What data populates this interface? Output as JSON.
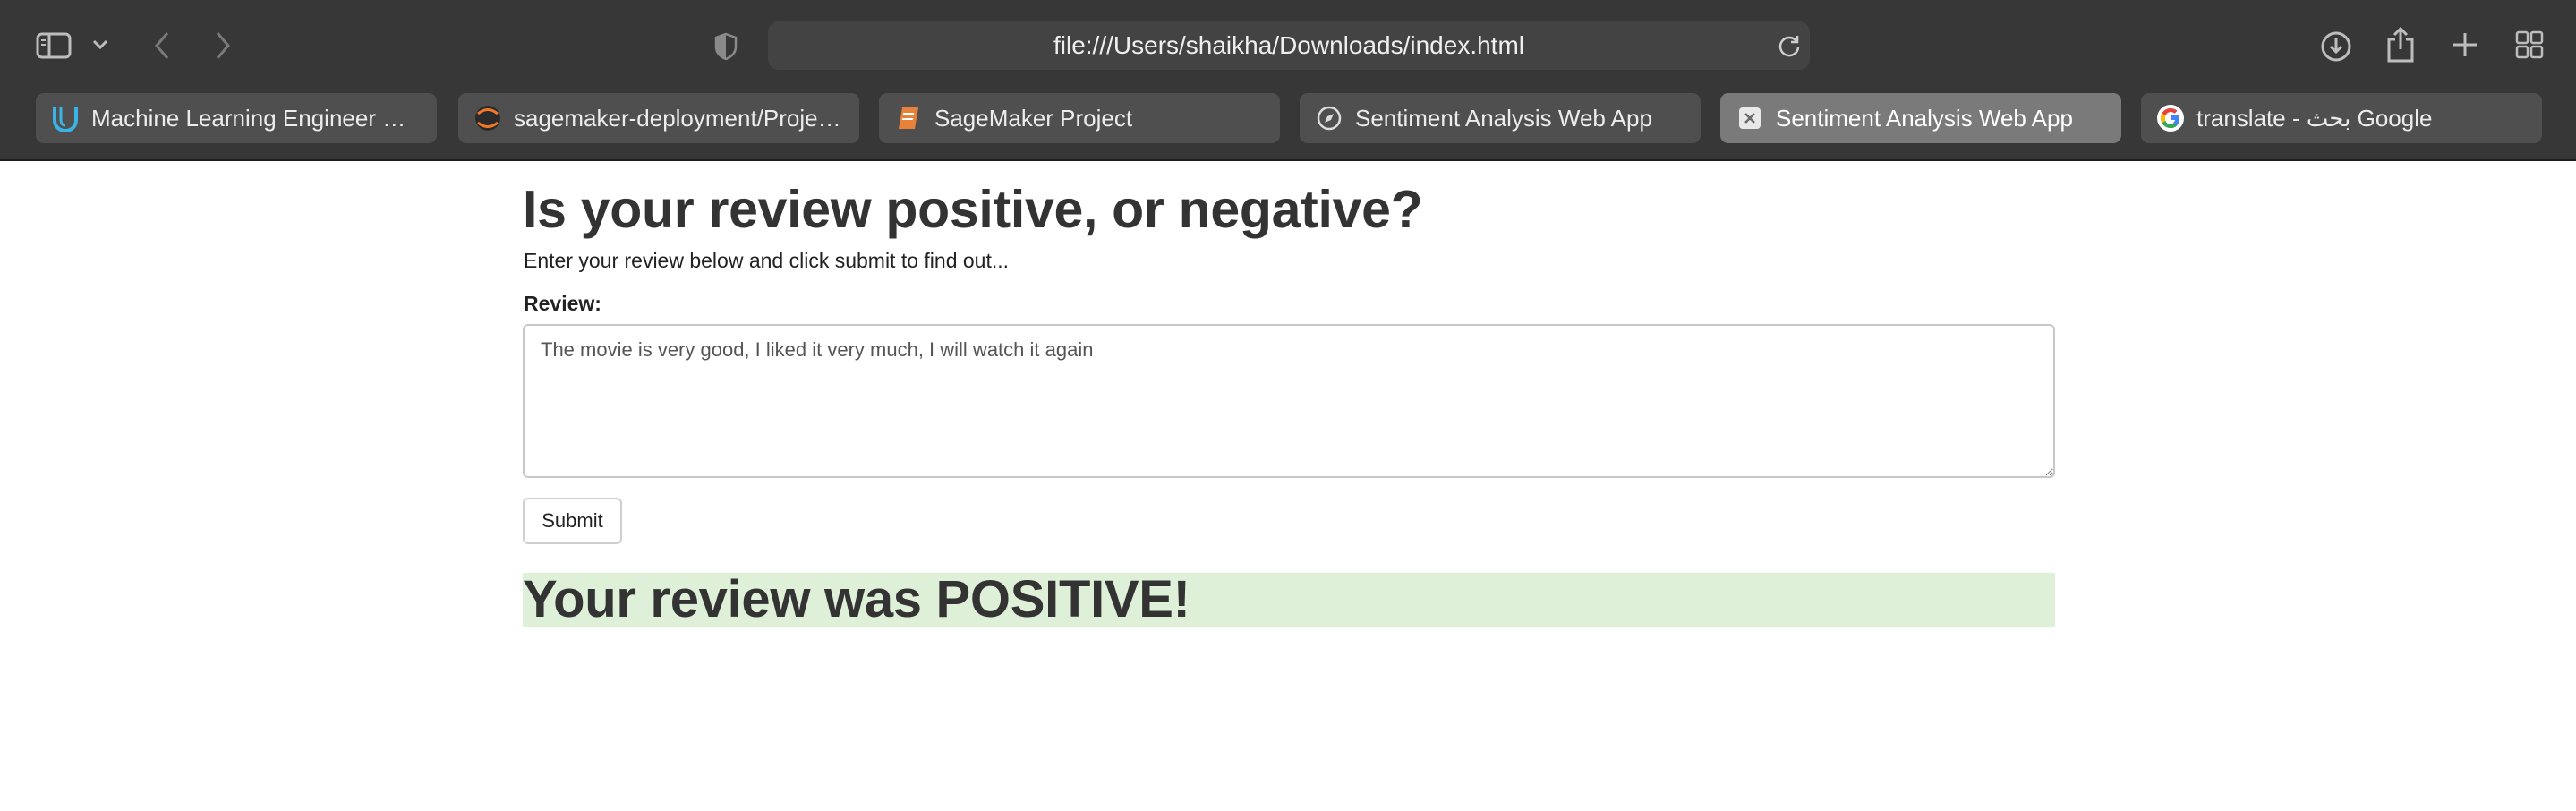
{
  "browser": {
    "url": "file:///Users/shaikha/Downloads/index.html",
    "toolbar_icons": [
      "sidebar-icon",
      "chevron-down-icon",
      "back-icon",
      "forward-icon",
      "privacy-shield-icon",
      "reload-icon",
      "download-icon",
      "share-icon",
      "new-tab-icon",
      "tab-overview-icon"
    ],
    "tabs": [
      {
        "title": "Machine Learning Engineer Na...",
        "icon": "udacity-icon",
        "active": false
      },
      {
        "title": "sagemaker-deployment/Projec...",
        "icon": "jupyter-icon",
        "active": false
      },
      {
        "title": "SageMaker Project",
        "icon": "notebook-icon",
        "active": false
      },
      {
        "title": "Sentiment Analysis Web App",
        "icon": "compass-icon",
        "active": false
      },
      {
        "title": "Sentiment Analysis Web App",
        "icon": "close-tab-icon",
        "active": true
      },
      {
        "title": "translate - بحث Google",
        "icon": "google-icon",
        "active": false
      }
    ]
  },
  "page": {
    "heading": "Is your review positive, or negative?",
    "intro": "Enter your review below and click submit to find out...",
    "review_label": "Review:",
    "review_value": "The movie is very good, I liked it very much, I will watch it again",
    "submit_label": "Submit",
    "result_text": "Your review was POSITIVE!",
    "result_color": "#dff0d8"
  }
}
